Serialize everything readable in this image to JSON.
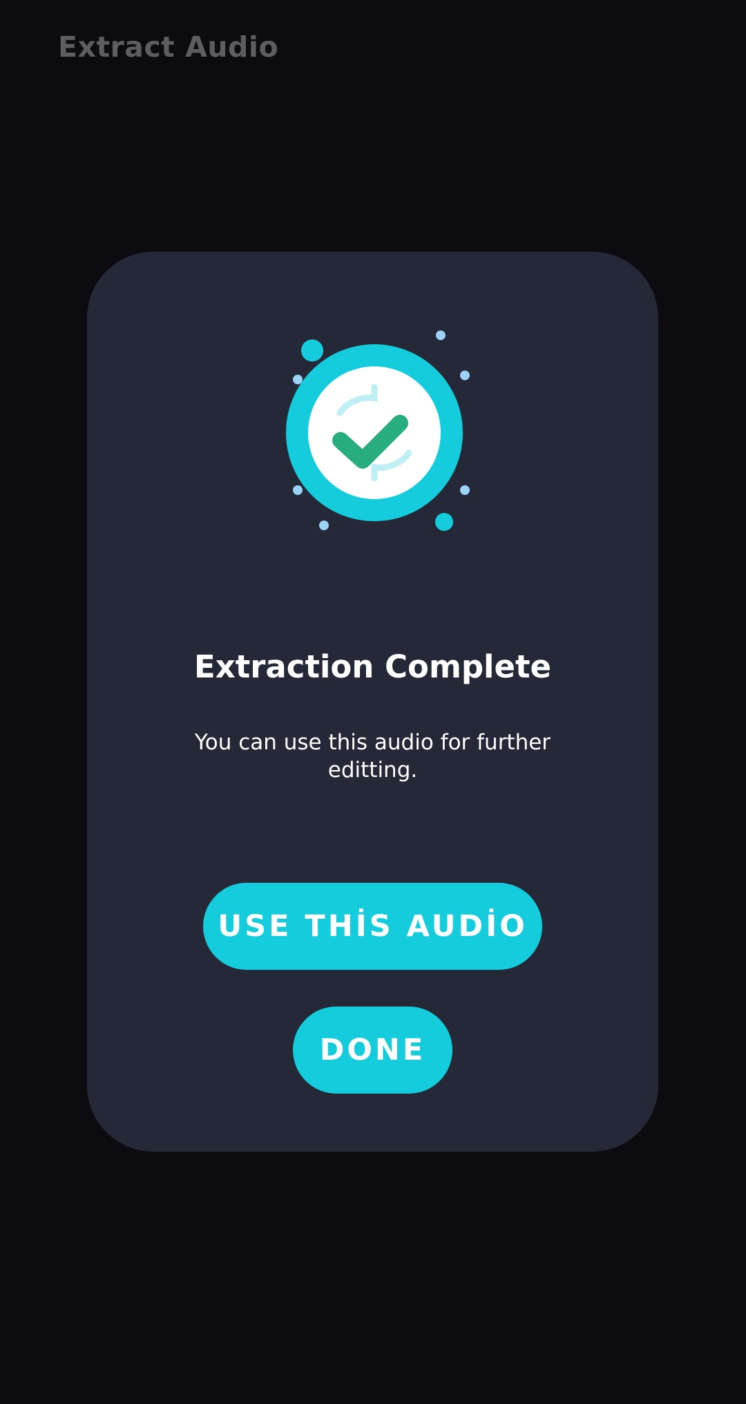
{
  "app_bar": {
    "title": "Extract Audio"
  },
  "dialog": {
    "icon": "check-circle-icon",
    "title": "Extraction Complete",
    "message": "You can use this audio for further editting.",
    "primary_button_label": "USE THİS AUDİO",
    "secondary_button_label": "DONE"
  },
  "colors": {
    "background": "#0c0c10",
    "dialog_background": "#252937",
    "accent": "#14ccdb",
    "check": "#27ad7e",
    "title_muted": "#5e5e62"
  }
}
